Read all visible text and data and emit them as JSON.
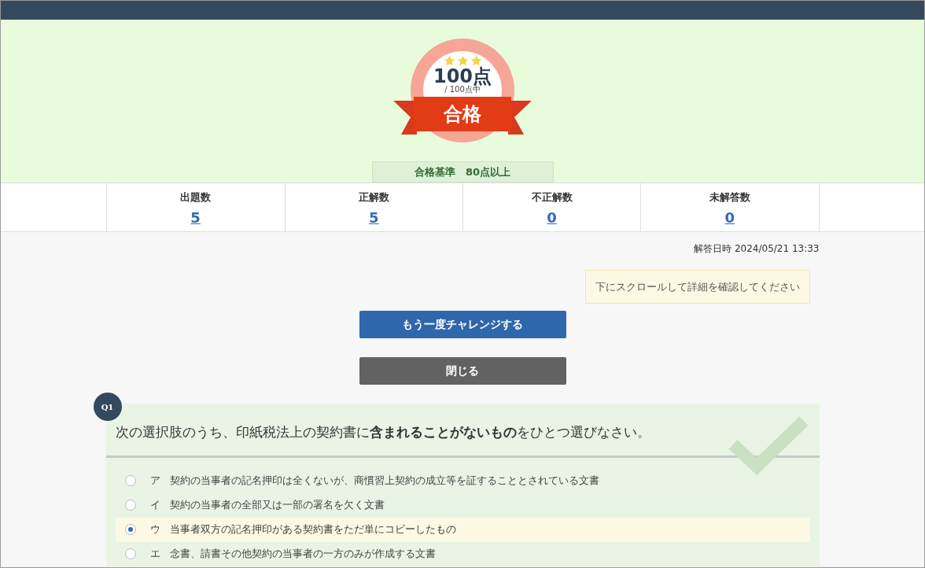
{
  "result": {
    "stars": 3,
    "score": "100点",
    "out_of": "/ 100点中",
    "verdict": "合格",
    "criteria": "合格基準　80点以上"
  },
  "stats": [
    {
      "label": "出題数",
      "value": "5"
    },
    {
      "label": "正解数",
      "value": "5"
    },
    {
      "label": "不正解数",
      "value": "0"
    },
    {
      "label": "未解答数",
      "value": "0"
    }
  ],
  "answered_at": "解答日時 2024/05/21 13:33",
  "notice": "下にスクロールして詳細を確認してください",
  "buttons": [
    {
      "kind": "primary",
      "label": "もう一度チャレンジする"
    },
    {
      "kind": "secondary",
      "label": "閉じる"
    }
  ],
  "question": {
    "number": "Q1",
    "correct": true,
    "text": "次の選択肢のうち、印紙税法上の契約書に**含まれることがないもの**をひとつ選びなさい。",
    "choices": [
      {
        "mark": "ア",
        "text": "契約の当事者の記名押印は全くないが、商慣習上契約の成立等を証することとされている文書",
        "selected": false
      },
      {
        "mark": "イ",
        "text": "契約の当事者の全部又は一部の署名を欠く文書",
        "selected": false
      },
      {
        "mark": "ウ",
        "text": "当事者双方の記名押印がある契約書をただ単にコピーしたもの",
        "selected": true
      },
      {
        "mark": "エ",
        "text": "念書、請書その他契約の当事者の一方のみが作成する文書",
        "selected": false
      }
    ]
  }
}
